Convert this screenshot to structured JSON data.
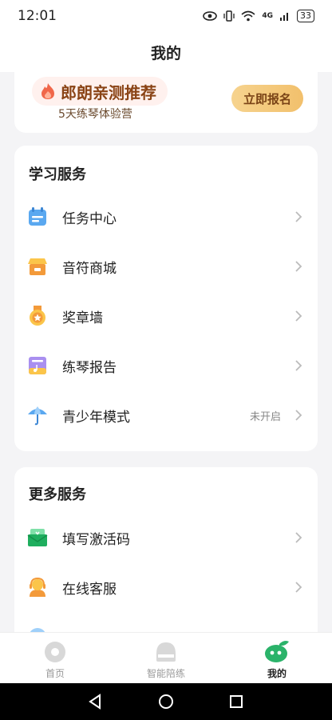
{
  "status_bar": {
    "time": "12:01",
    "network": "4G",
    "battery": "33"
  },
  "header": {
    "title": "我的"
  },
  "promo": {
    "title": "郎朗亲测推荐",
    "subtitle": "5天练琴体验营",
    "button": "立即报名"
  },
  "learning_services": {
    "title": "学习服务",
    "items": [
      {
        "label": "任务中心",
        "icon": "calendar-icon",
        "status": ""
      },
      {
        "label": "音符商城",
        "icon": "store-icon",
        "status": ""
      },
      {
        "label": "奖章墙",
        "icon": "medal-icon",
        "status": ""
      },
      {
        "label": "练琴报告",
        "icon": "report-icon",
        "status": ""
      },
      {
        "label": "青少年模式",
        "icon": "umbrella-icon",
        "status": "未开启"
      }
    ]
  },
  "more_services": {
    "title": "更多服务",
    "items": [
      {
        "label": "填写激活码",
        "icon": "envelope-icon"
      },
      {
        "label": "在线客服",
        "icon": "customer-service-icon"
      }
    ]
  },
  "tabs": [
    {
      "label": "首页",
      "active": false
    },
    {
      "label": "智能陪练",
      "active": false
    },
    {
      "label": "我的",
      "active": true
    }
  ],
  "colors": {
    "accent_green": "#2bb36a",
    "promo_gold": "#f2c06c"
  }
}
